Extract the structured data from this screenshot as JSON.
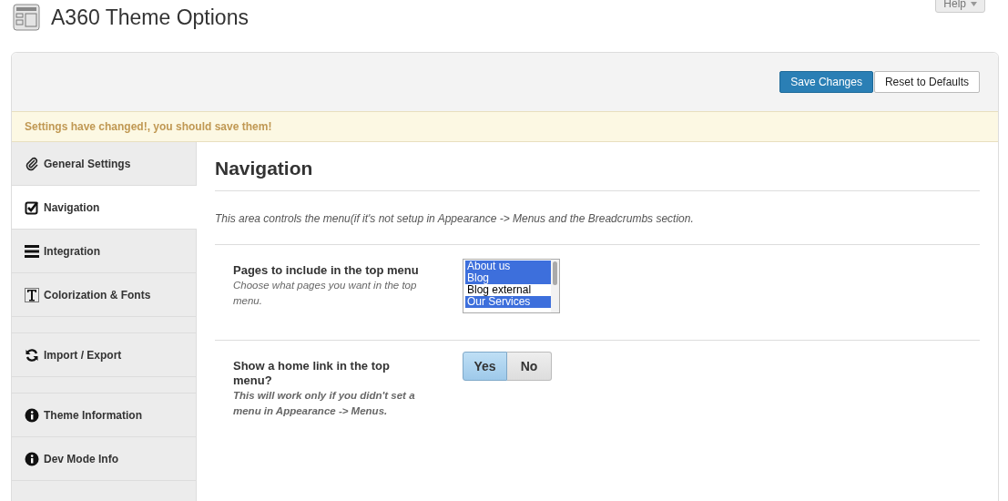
{
  "page_title": "A360 Theme Options",
  "help_button": {
    "label": "Help"
  },
  "header_buttons": [
    {
      "label": "Save Changes",
      "kind": "primary"
    },
    {
      "label": "Reset to Defaults",
      "kind": "secondary"
    }
  ],
  "notice": "Settings have changed!, you should save them!",
  "sidebar": {
    "groups": [
      {
        "items": [
          {
            "label": "General Settings",
            "kind": "paperclip",
            "selected": false
          },
          {
            "label": "Navigation",
            "kind": "checkbox",
            "selected": true
          },
          {
            "label": "Integration",
            "kind": "bars",
            "selected": false
          },
          {
            "label": "Colorization & Fonts",
            "kind": "text",
            "selected": false
          }
        ]
      },
      {
        "items": [
          {
            "label": "Import / Export",
            "kind": "refresh",
            "selected": false
          }
        ]
      },
      {
        "items": [
          {
            "label": "Theme Information",
            "kind": "info",
            "selected": false
          },
          {
            "label": "Dev Mode Info",
            "kind": "info",
            "selected": false
          }
        ]
      }
    ]
  },
  "section": {
    "title": "Navigation",
    "description": "This area controls the menu(if it's not setup in Appearance -> Menus and the Breadcrumbs section.",
    "fields": [
      {
        "kind": "multiselect",
        "label": "Pages to include in the top menu",
        "hint": "Choose what pages you want in the top menu.",
        "options": [
          {
            "label": "About us",
            "selected": true
          },
          {
            "label": "Blog",
            "selected": true
          },
          {
            "label": "Blog external",
            "selected": false
          },
          {
            "label": "Our Services",
            "selected": true
          }
        ]
      },
      {
        "kind": "toggle",
        "label": "Show a home link in the top menu?",
        "hint": "This will work only if you didn't set a menu in Appearance -> Menus.",
        "options": [
          {
            "label": "Yes",
            "selected": true
          },
          {
            "label": "No",
            "selected": false
          }
        ]
      }
    ]
  }
}
